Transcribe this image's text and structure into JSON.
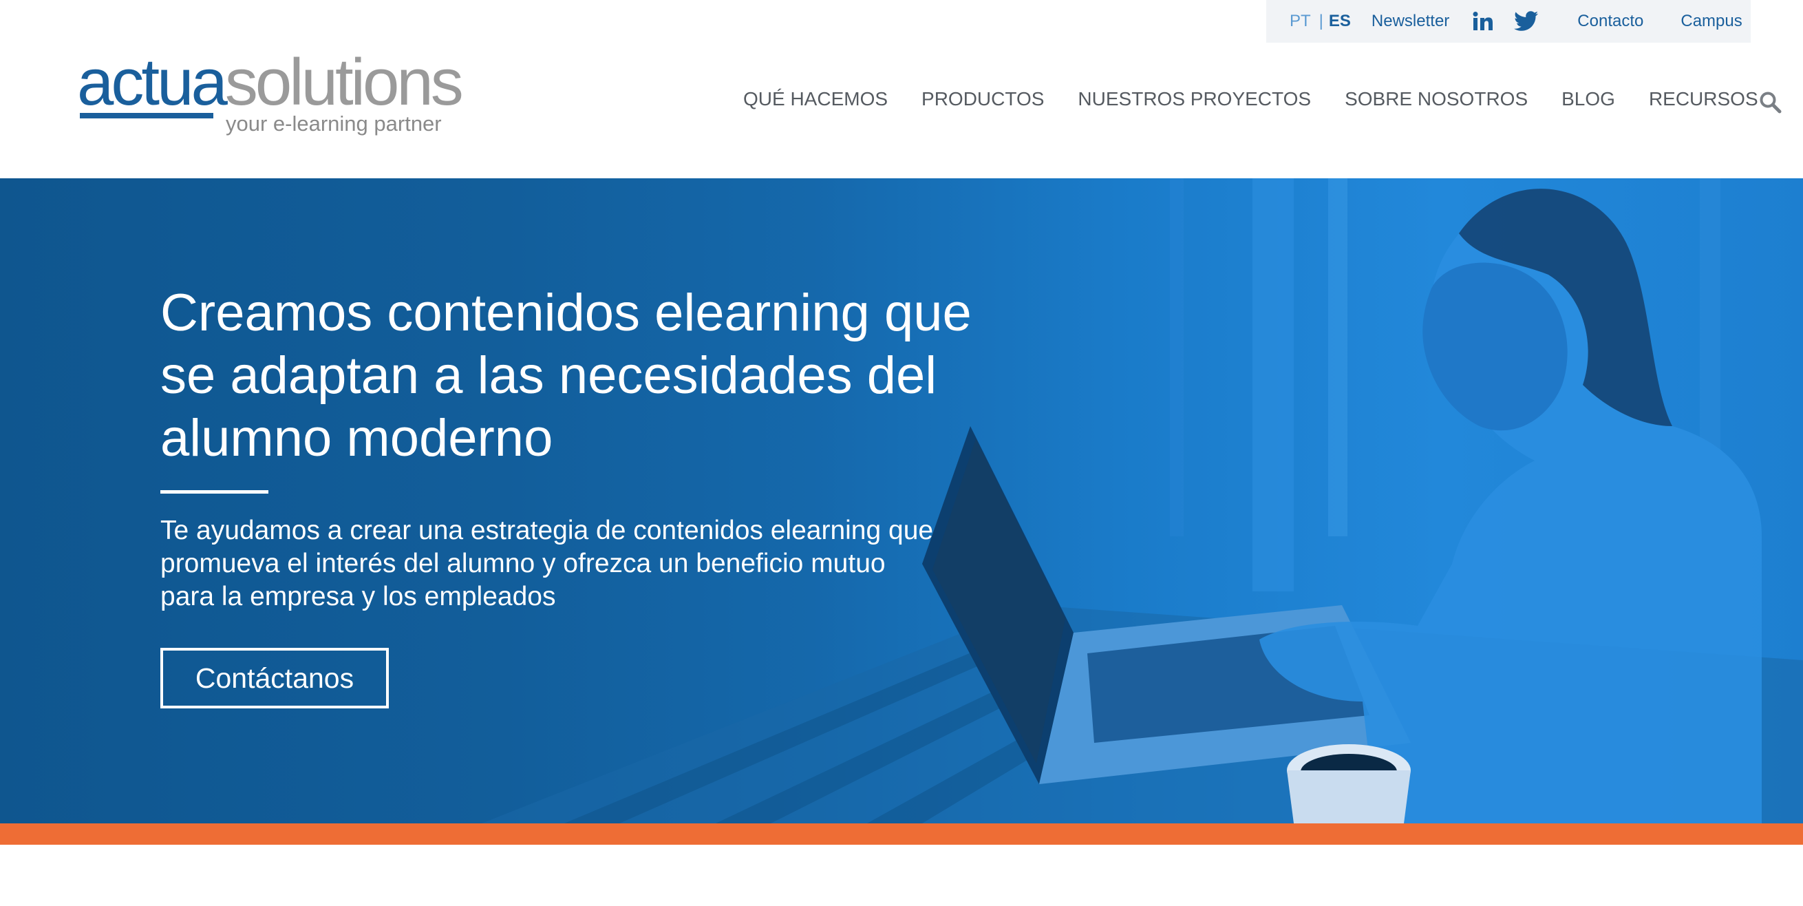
{
  "utility": {
    "lang_pt": "PT",
    "lang_sep": "|",
    "lang_es": "ES",
    "newsletter": "Newsletter",
    "contacto": "Contacto",
    "campus": "Campus",
    "icons": [
      "linkedin-icon",
      "twitter-icon"
    ]
  },
  "logo": {
    "word_a": "actua",
    "word_b": "solutions",
    "tagline": "your e-learning partner"
  },
  "nav": {
    "items": [
      "QUÉ HACEMOS",
      "PRODUCTOS",
      "NUESTROS PROYECTOS",
      "SOBRE NOSOTROS",
      "BLOG",
      "RECURSOS"
    ],
    "search_icon": "search-icon"
  },
  "hero": {
    "title": "Creamos contenidos elearning que se adaptan a las necesidades del alumno moderno",
    "subtitle": "Te ayudamos a crear una estrategia de contenidos elearning que promueva el interés del alumno y ofrezca un beneficio mutuo para la empresa y los empleados",
    "cta": "Contáctanos"
  },
  "colors": {
    "brand_blue": "#1a5f9c",
    "accent_orange": "#ee6d35",
    "hero_blue": "#1568ab"
  }
}
